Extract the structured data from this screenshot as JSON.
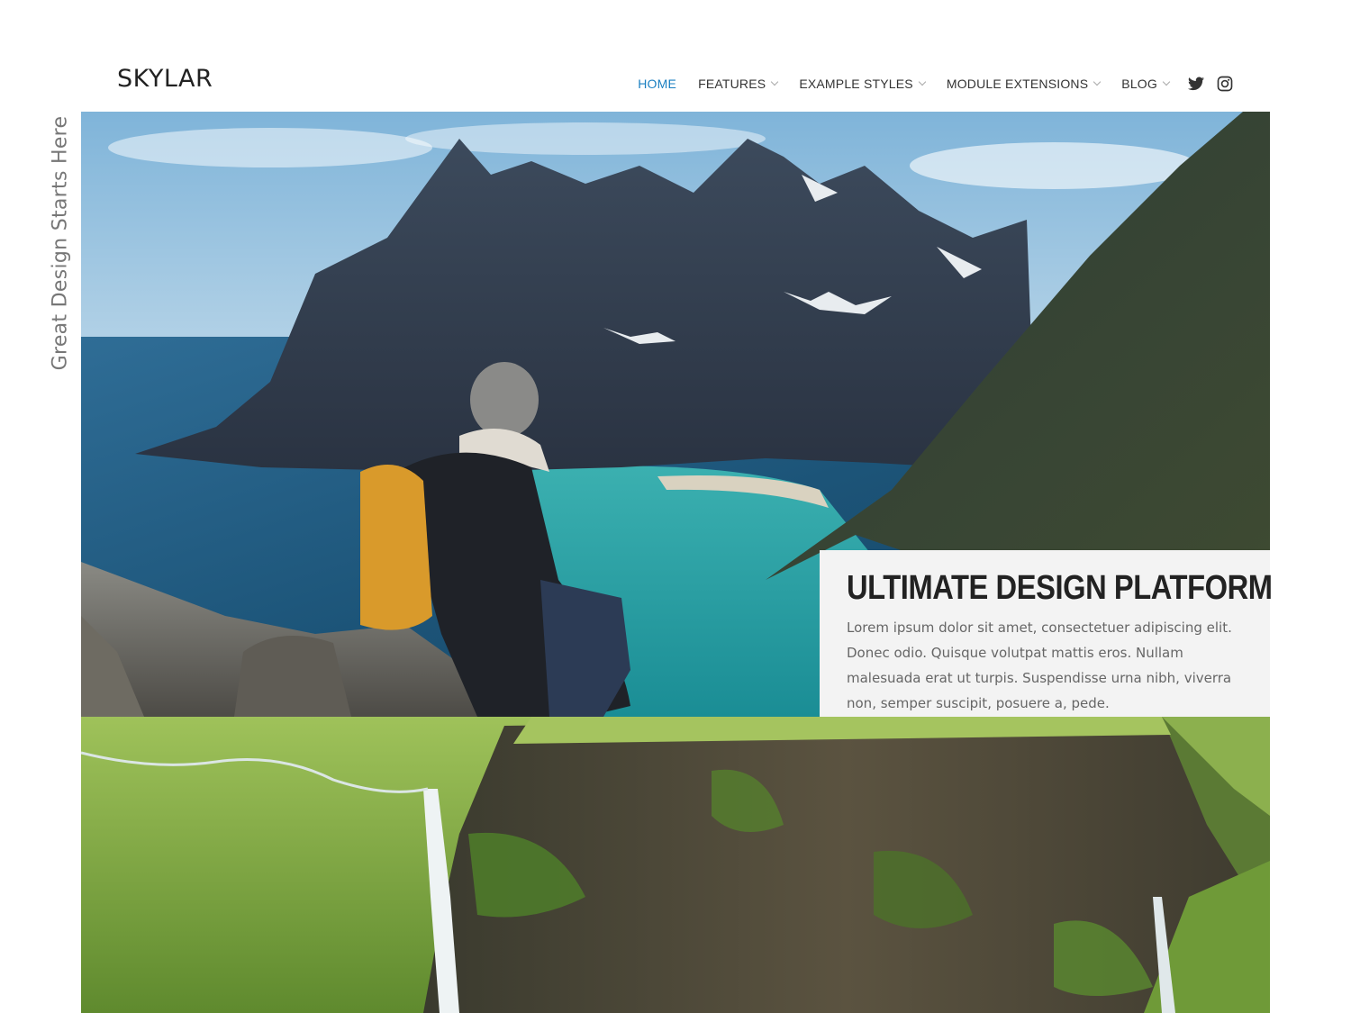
{
  "header": {
    "logo": "SKYLAR",
    "nav": [
      {
        "label": "Home",
        "active": true,
        "dropdown": false
      },
      {
        "label": "Features",
        "active": false,
        "dropdown": true
      },
      {
        "label": "Example Styles",
        "active": false,
        "dropdown": true
      },
      {
        "label": "Module Extensions",
        "active": false,
        "dropdown": true
      },
      {
        "label": "Blog",
        "active": false,
        "dropdown": true
      }
    ],
    "social": [
      "twitter-icon",
      "instagram-icon"
    ],
    "active_color": "#1a7fc1"
  },
  "tagline": "Great Design Starts Here",
  "hero": {
    "image": "hiker-on-mountain-overlooking-bay"
  },
  "card": {
    "title": "Ultimate Design Platform",
    "text": "Lorem ipsum dolor sit amet, consectetuer adipiscing elit. Donec odio. Quisque volutpat mattis eros. Nullam malesuada erat ut turpis. Suspendisse urna nibh, viverra non, semper suscipit, posuere a, pede."
  },
  "bottom_image": "green-cliffs-waterfall"
}
